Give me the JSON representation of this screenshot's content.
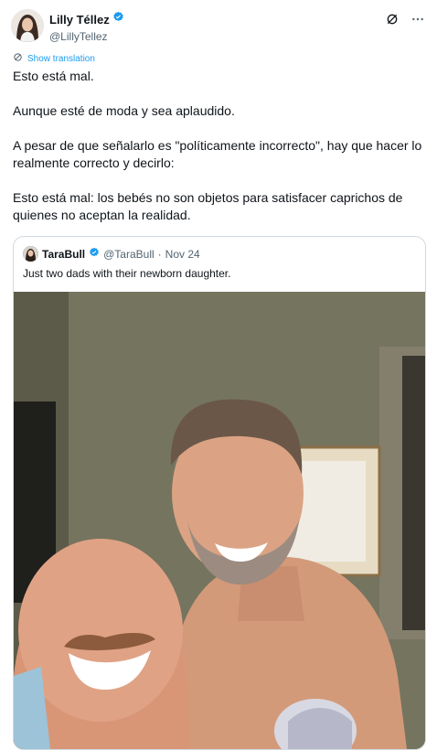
{
  "tweet": {
    "author": {
      "display_name": "Lilly Téllez",
      "handle": "@LillyTellez",
      "verified": true
    },
    "translate_label": "Show translation",
    "paragraphs": [
      "Esto está mal.",
      "Aunque esté de moda y sea aplaudido.",
      "A pesar de que señalarlo es \"políticamente incorrecto\", hay que hacer lo realmente correcto y decirlo:",
      "Esto está mal: los bebés no son objetos para satisfacer caprichos de quienes no aceptan la realidad."
    ]
  },
  "quoted": {
    "display_name": "TaraBull",
    "handle": "@TaraBull",
    "dot": "·",
    "date": "Nov 24",
    "verified": true,
    "text": "Just two dads with their newborn daughter."
  },
  "icons": {
    "verified": "verified-badge-icon",
    "grok": "grok-icon",
    "more": "more-icon",
    "translate": "translate-icon"
  },
  "colors": {
    "accent": "#1d9bf0",
    "secondary_text": "#536471",
    "border": "#cfd9de"
  }
}
